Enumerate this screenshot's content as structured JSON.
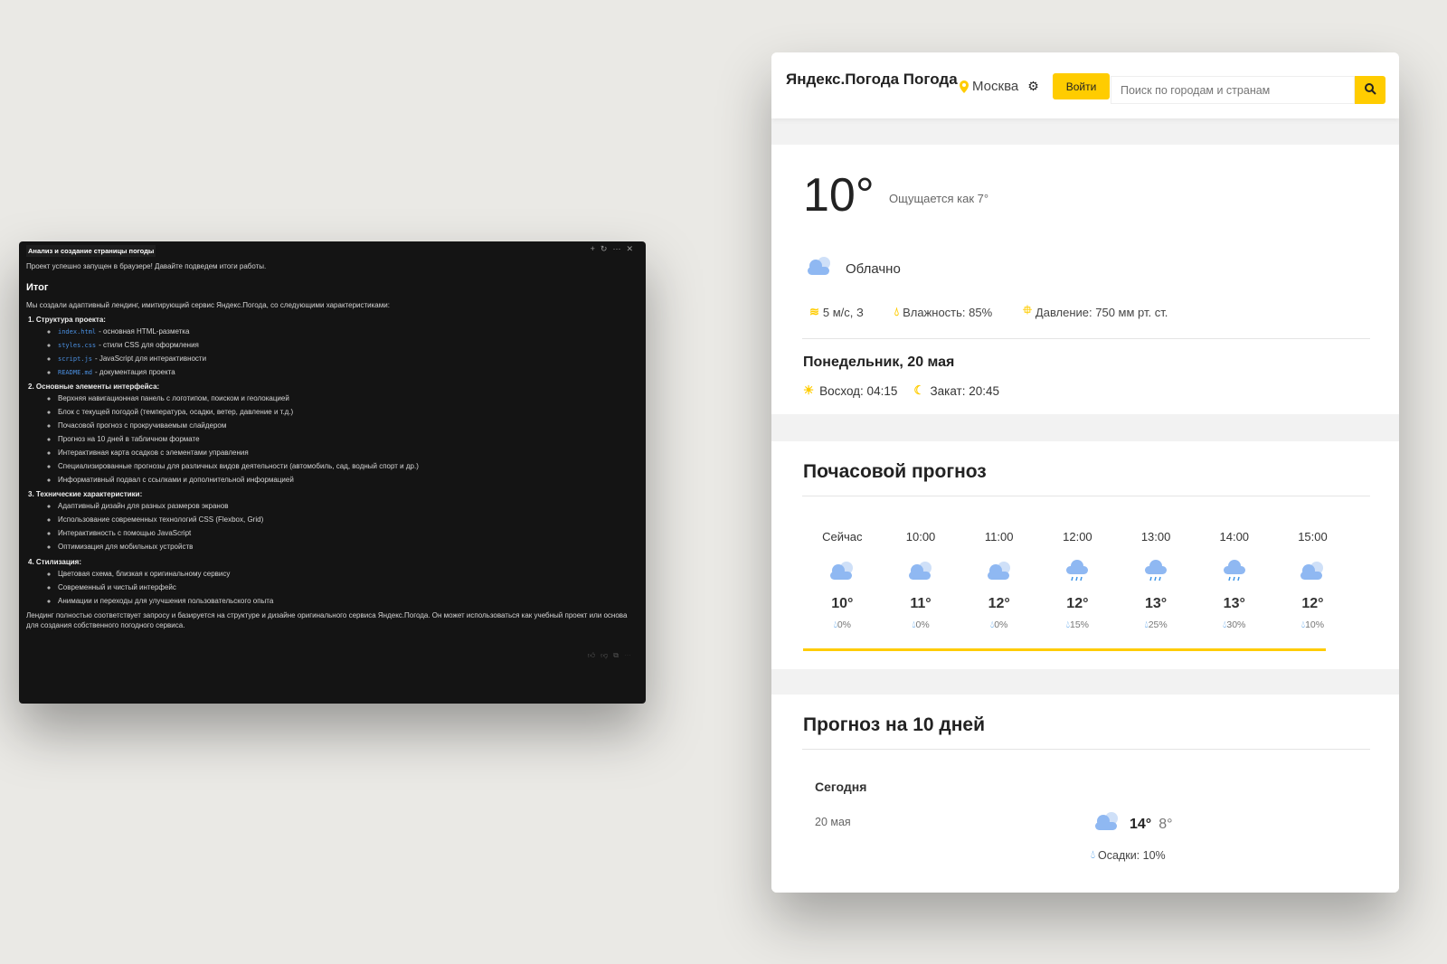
{
  "chat": {
    "title": "Анализ и создание страницы погоды",
    "intro": "Проект успешно запущен в браузере! Давайте подведем итоги работы.",
    "heading": "Итог",
    "summary": "Мы создали адаптивный лендинг, имитирующий сервис Яндекс.Погода, со следующими характеристиками:",
    "sections": [
      {
        "title": "1. Структура проекта:",
        "items": [
          {
            "code": "index.html",
            "text": "- основная HTML-разметка"
          },
          {
            "code": "styles.css",
            "text": "- стили CSS для оформления"
          },
          {
            "code": "script.js",
            "text": "- JavaScript для интерактивности"
          },
          {
            "code": "README.md",
            "text": "- документация проекта"
          }
        ]
      },
      {
        "title": "2. Основные элементы интерфейса:",
        "items": [
          {
            "text": "Верхняя навигационная панель с логотипом, поиском и геолокацией"
          },
          {
            "text": "Блок с текущей погодой (температура, осадки, ветер, давление и т.д.)"
          },
          {
            "text": "Почасовой прогноз с прокручиваемым слайдером"
          },
          {
            "text": "Прогноз на 10 дней в табличном формате"
          },
          {
            "text": "Интерактивная карта осадков с элементами управления"
          },
          {
            "text": "Специализированные прогнозы для различных видов деятельности (автомобиль, сад, водный спорт и др.)"
          },
          {
            "text": "Информативный подвал с ссылками и дополнительной информацией"
          }
        ]
      },
      {
        "title": "3. Технические характеристики:",
        "items": [
          {
            "text": "Адаптивный дизайн для разных размеров экранов"
          },
          {
            "text": "Использование современных технологий CSS (Flexbox, Grid)"
          },
          {
            "text": "Интерактивность с помощью JavaScript"
          },
          {
            "text": "Оптимизация для мобильных устройств"
          }
        ]
      },
      {
        "title": "4. Стилизация:",
        "items": [
          {
            "text": "Цветовая схема, близкая к оригинальному сервису"
          },
          {
            "text": "Современный и чистый интерфейс"
          },
          {
            "text": "Анимации и переходы для улучшения пользовательского опыта"
          }
        ]
      }
    ],
    "conclusion": "Лендинг полностью соответствует запросу и базируется на структуре и дизайне оригинального сервиса Яндекс.Погода. Он может использоваться как учебный проект или основа для создания собственного погодного сервиса."
  },
  "weather": {
    "logo": "Яндекс.Погода Погода",
    "city": "Москва",
    "login": "Войти",
    "search_placeholder": "Поиск по городам и странам",
    "accent": "#ffcc00",
    "current": {
      "temp": "10°",
      "feels": "Ощущается как 7°",
      "condition": "Облачно",
      "wind": "5 м/с, З",
      "humidity": "Влажность: 85%",
      "pressure": "Давление: 750 мм рт. ст.",
      "date": "Понедельник, 20 мая",
      "sunrise": "Восход: 04:15",
      "sunset": "Закат: 20:45"
    },
    "hourly_title": "Почасовой прогноз",
    "hourly": [
      {
        "time": "Сейчас",
        "icon": "cloudy",
        "temp": "10°",
        "precip": "0%"
      },
      {
        "time": "10:00",
        "icon": "cloudy",
        "temp": "11°",
        "precip": "0%"
      },
      {
        "time": "11:00",
        "icon": "cloudy",
        "temp": "12°",
        "precip": "0%"
      },
      {
        "time": "12:00",
        "icon": "rain",
        "temp": "12°",
        "precip": "15%"
      },
      {
        "time": "13:00",
        "icon": "rain",
        "temp": "13°",
        "precip": "25%"
      },
      {
        "time": "14:00",
        "icon": "rain",
        "temp": "13°",
        "precip": "30%"
      },
      {
        "time": "15:00",
        "icon": "cloudy",
        "temp": "12°",
        "precip": "10%"
      }
    ],
    "daily_title": "Прогноз на 10 дней",
    "daily": [
      {
        "day": "Сегодня",
        "date": "20 мая",
        "high": "14°",
        "low": "8°",
        "precip": "Осадки: 10%"
      }
    ]
  }
}
